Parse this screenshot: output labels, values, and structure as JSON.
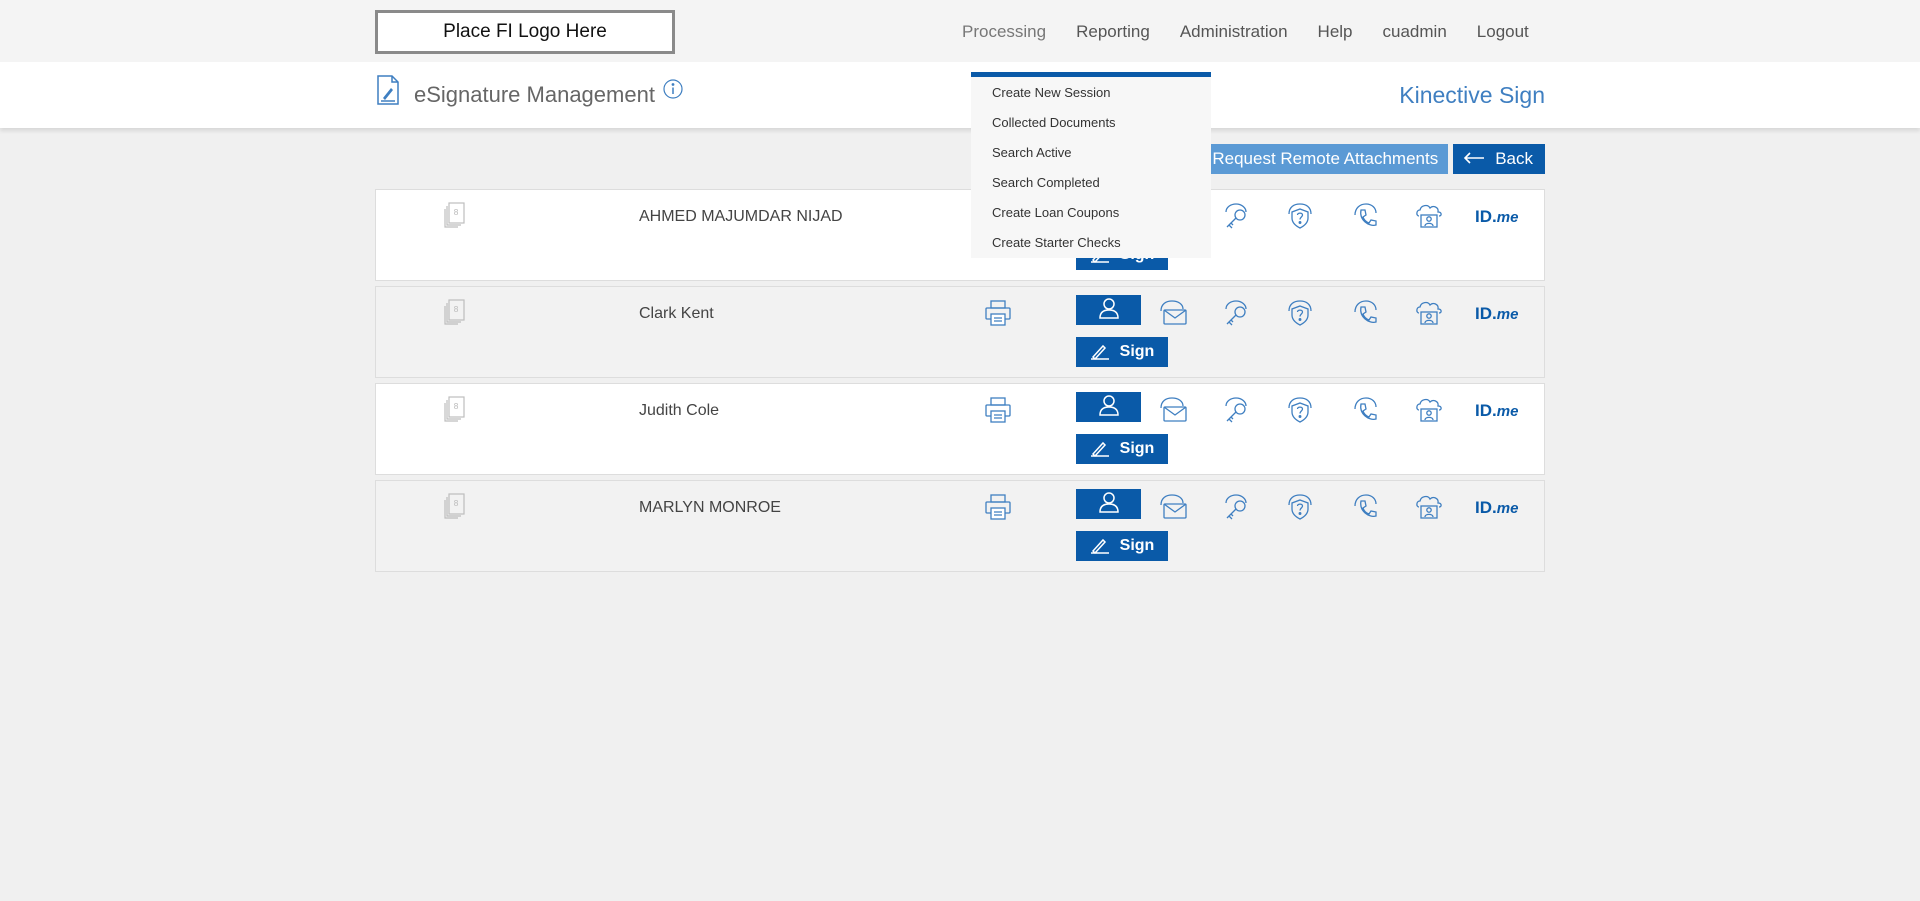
{
  "header": {
    "logo_text": "Place FI Logo Here",
    "nav": [
      "Processing",
      "Reporting",
      "Administration",
      "Help",
      "cuadmin",
      "Logout"
    ]
  },
  "subheader": {
    "title": "eSignature Management",
    "brand": "Kinective Sign"
  },
  "dropdown": {
    "items": [
      "Create New Session",
      "Collected Documents",
      "Search Active",
      "Search Completed",
      "Create Loan Coupons",
      "Create Starter Checks"
    ]
  },
  "actions": {
    "remote_label": "Request Remote Attachments",
    "back_label": "Back"
  },
  "rows": [
    {
      "name": "AHMED MAJUMDAR NIJAD",
      "pages": "8",
      "sign_label": "Sign",
      "idme_id": "ID.",
      "idme_me": "me"
    },
    {
      "name": "Clark Kent",
      "pages": "8",
      "sign_label": "Sign",
      "idme_id": "ID.",
      "idme_me": "me"
    },
    {
      "name": "Judith Cole",
      "pages": "8",
      "sign_label": "Sign",
      "idme_id": "ID.",
      "idme_me": "me"
    },
    {
      "name": "MARLYN MONROE",
      "pages": "8",
      "sign_label": "Sign",
      "idme_id": "ID.",
      "idme_me": "me"
    }
  ],
  "colors": {
    "primary": "#0a5aa8",
    "secondary_button": "#5b9ad5",
    "brand_text": "#3f7fc1",
    "background": "#f0f0f0"
  },
  "icons": [
    "document-icon",
    "info-icon",
    "paperclip-icon",
    "back-arrow-icon",
    "pages-icon",
    "printer-icon",
    "person-icon",
    "pen-icon",
    "mail-icon",
    "key-icon",
    "shield-question-icon",
    "phone-icon",
    "cloud-user-icon",
    "idme-logo"
  ]
}
